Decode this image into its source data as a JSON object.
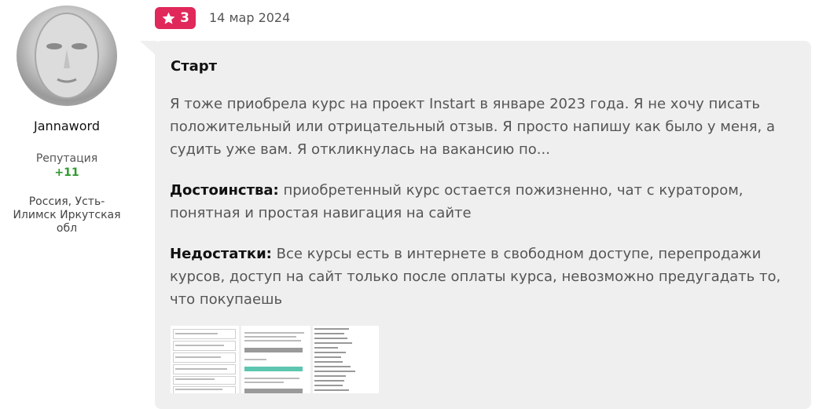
{
  "author": {
    "username": "Jannaword",
    "reputation_label": "Репутация",
    "reputation_value": "+11",
    "location": "Россия, Усть-Илимск Иркутская обл"
  },
  "review": {
    "rating": "3",
    "date": "14 мар 2024",
    "title": "Старт",
    "body": "Я тоже приобрела курс на проект Instart в январе 2023 года. Я не хочу писать положительный или отрицательный отзыв. Я просто напишу как было у меня, а судить уже вам. Я откликнулась на вакансию по...",
    "pros_label": "Достоинства:",
    "pros_text": " приобретенный курс остается пожизненно, чат с куратором, понятная и простая навигация на сайте",
    "cons_label": "Недостатки:",
    "cons_text": " Все курсы есть в интернете в свободном доступе, перепродажи курсов, доступ на сайт только после оплаты курса, невозможно предугадать то, что покупаешь"
  },
  "colors": {
    "rating_badge": "#e0285a",
    "reputation_positive": "#2e9a2e",
    "bubble_bg": "#efefef"
  },
  "icons": {
    "rating": "star-icon"
  }
}
